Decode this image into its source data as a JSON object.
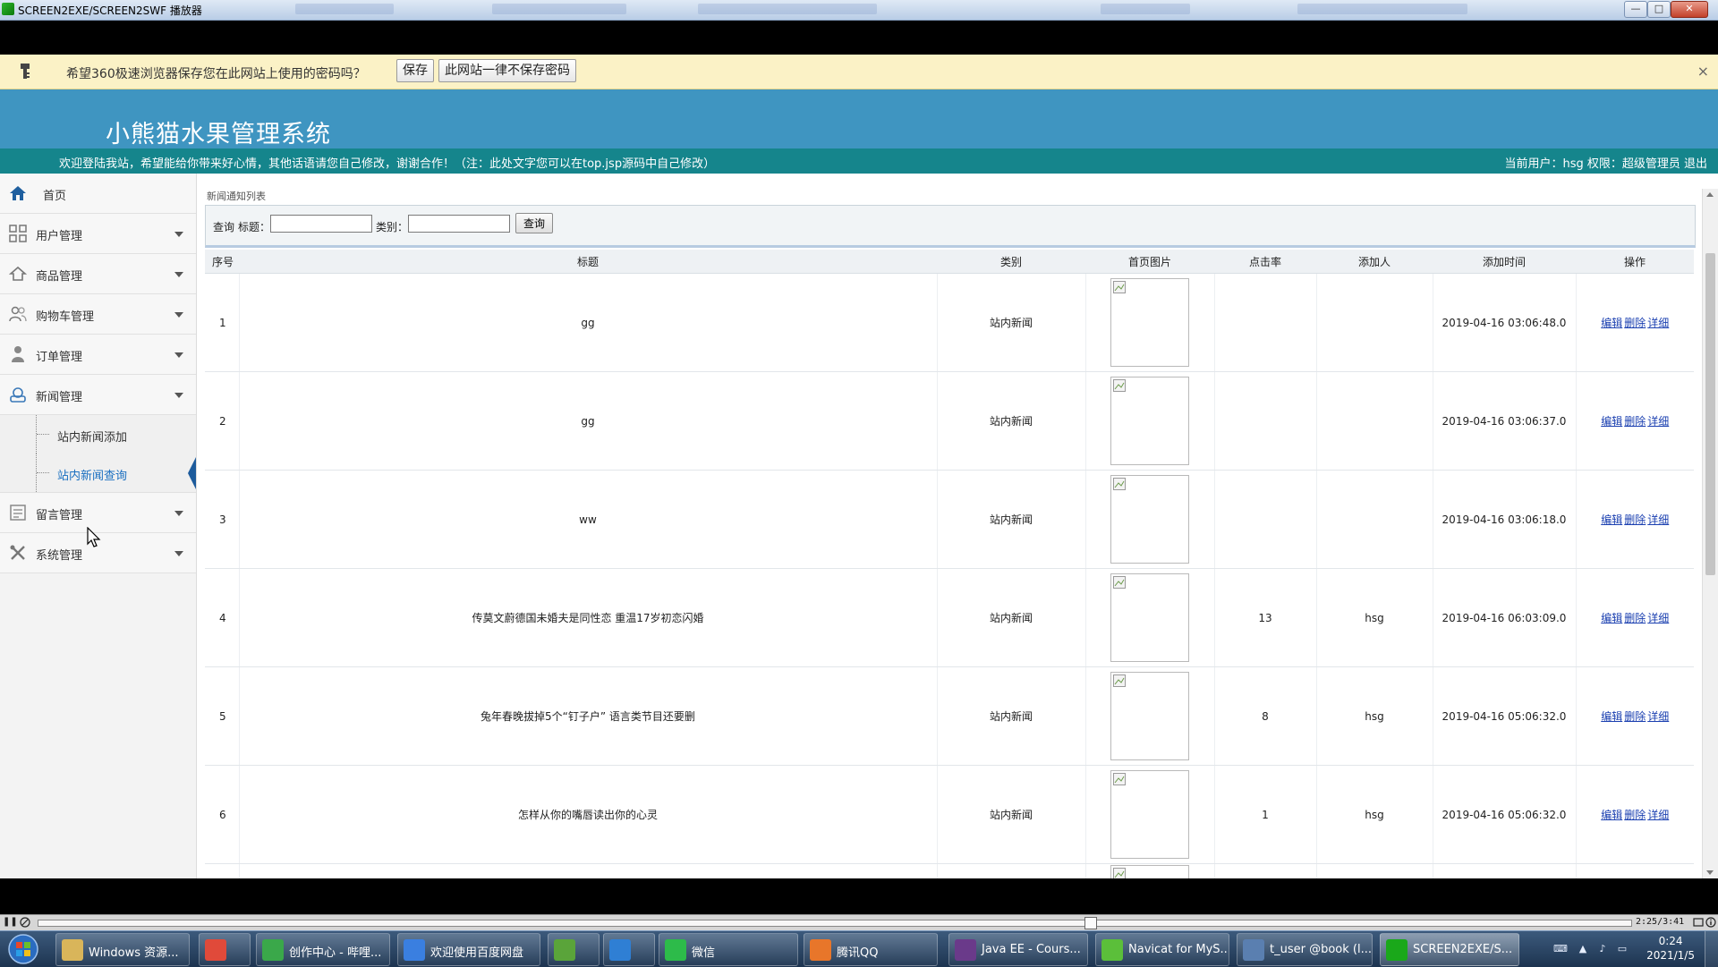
{
  "window": {
    "title": "SCREEN2EXE/SCREEN2SWF 播放器",
    "min_glyph": "—",
    "max_glyph": "□",
    "close_glyph": "✕"
  },
  "password_bar": {
    "message": "希望360极速浏览器保存您在此网站上使用的密码吗？",
    "save_label": "保存",
    "never_label": "此网站一律不保存密码",
    "close_glyph": "×"
  },
  "app": {
    "title": "小熊猫水果管理系统",
    "welcome": "欢迎登陆我站，希望能给你带来好心情，其他话语请您自己修改，谢谢合作！（注：此处文字您可以在top.jsp源码中自己修改）",
    "user_info": "当前用户：hsg   权限：超级管理员  退出"
  },
  "sidebar": {
    "home": "首页",
    "items": [
      {
        "label": "用户管理"
      },
      {
        "label": "商品管理"
      },
      {
        "label": "购物车管理"
      },
      {
        "label": "订单管理"
      },
      {
        "label": "新闻管理"
      },
      {
        "label": "留言管理"
      },
      {
        "label": "系统管理"
      }
    ],
    "news_sub": [
      {
        "label": "站内新闻添加"
      },
      {
        "label": "站内新闻查询"
      }
    ]
  },
  "content": {
    "breadcrumb": "新闻通知列表",
    "query": {
      "query_label": "查询",
      "title_label": "标题：",
      "title_value": "",
      "category_label": "类别：",
      "category_value": "",
      "button": "查询"
    },
    "table": {
      "headers": [
        "序号",
        "标题",
        "类别",
        "首页图片",
        "点击率",
        "添加人",
        "添加时间",
        "操作"
      ],
      "rows": [
        {
          "no": "1",
          "title": "gg",
          "category": "站内新闻",
          "clicks": "",
          "author": "",
          "time": "2019-04-16 03:06:48.0"
        },
        {
          "no": "2",
          "title": "gg",
          "category": "站内新闻",
          "clicks": "",
          "author": "",
          "time": "2019-04-16 03:06:37.0"
        },
        {
          "no": "3",
          "title": "ww",
          "category": "站内新闻",
          "clicks": "",
          "author": "",
          "time": "2019-04-16 03:06:18.0"
        },
        {
          "no": "4",
          "title": "传莫文蔚德国未婚夫是同性恋 重温17岁初恋闪婚",
          "category": "站内新闻",
          "clicks": "13",
          "author": "hsg",
          "time": "2019-04-16 06:03:09.0"
        },
        {
          "no": "5",
          "title": "兔年春晚拔掉5个“钉子户” 语言类节目还要删",
          "category": "站内新闻",
          "clicks": "8",
          "author": "hsg",
          "time": "2019-04-16 05:06:32.0"
        },
        {
          "no": "6",
          "title": "怎样从你的嘴唇读出你的心灵",
          "category": "站内新闻",
          "clicks": "1",
          "author": "hsg",
          "time": "2019-04-16 05:06:32.0"
        }
      ],
      "ops": {
        "edit": "编辑",
        "delete": "删除",
        "detail": "详细"
      }
    }
  },
  "player": {
    "pause_glyph": "❚❚",
    "time": "2:25/3:41",
    "progress": 0.66
  },
  "taskbar": {
    "items": [
      {
        "label": "Windows 资源...",
        "color": "#d9b55a"
      },
      {
        "label": "",
        "color": "#e04a3a"
      },
      {
        "label": "创作中心 - 哔哩...",
        "color": "#3aa84a"
      },
      {
        "label": "欢迎使用百度网盘",
        "color": "#3a7fe0"
      },
      {
        "label": "",
        "color": "#5aa43a"
      },
      {
        "label": "",
        "color": "#2f7fd4"
      },
      {
        "label": "微信",
        "color": "#2dbb4a"
      },
      {
        "label": "腾讯QQ",
        "color": "#e8762a"
      },
      {
        "label": "Java EE - Cours...",
        "color": "#6a3a8a"
      },
      {
        "label": "Navicat for MyS...",
        "color": "#5bbf3a"
      },
      {
        "label": "t_user @book (l...",
        "color": "#5a7fb0"
      },
      {
        "label": "SCREEN2EXE/S...",
        "color": "#1aa81a"
      }
    ],
    "clock_time": "0:24",
    "clock_date": "2021/1/5"
  }
}
